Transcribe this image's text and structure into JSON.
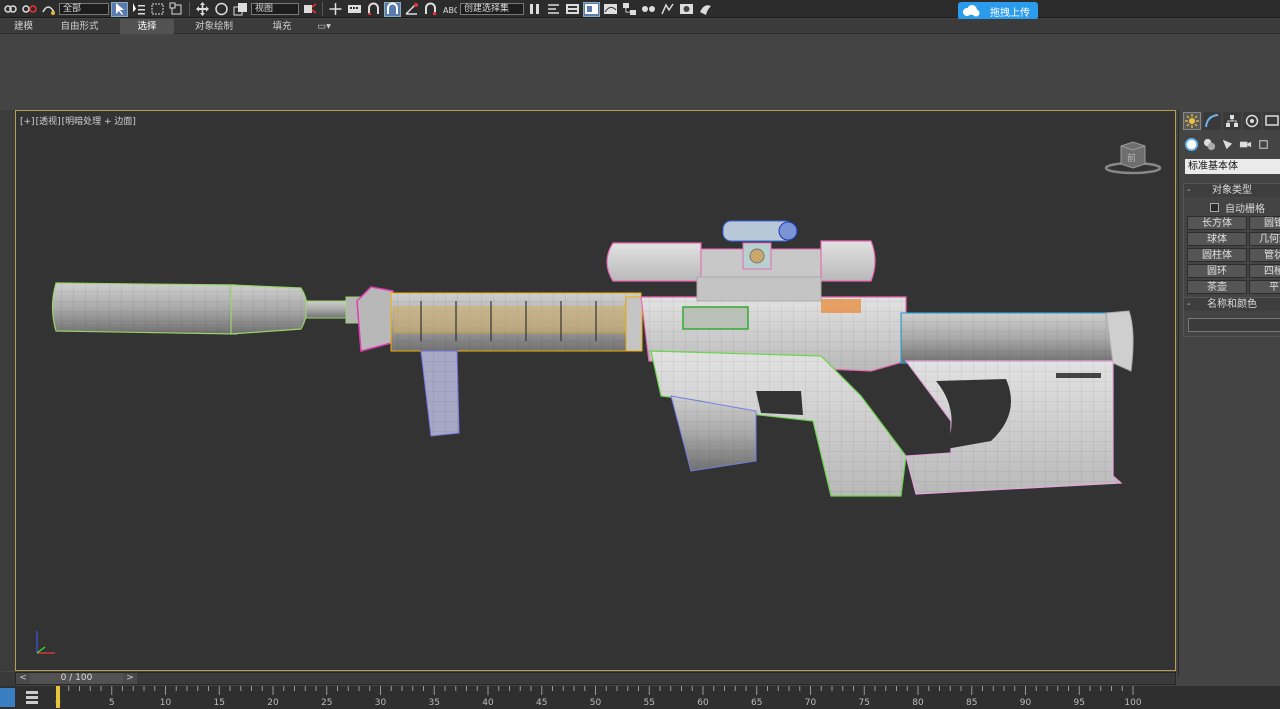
{
  "toolbar": {
    "selection_filter": "全部",
    "ref_coord": "视图",
    "named_selection": "创建选择集",
    "upload_label": "拖拽上传"
  },
  "ribbon": {
    "tabs": [
      {
        "label": "建模",
        "active": false
      },
      {
        "label": "自由形式",
        "active": false
      },
      {
        "label": "选择",
        "active": true
      },
      {
        "label": "对象绘制",
        "active": false
      },
      {
        "label": "填充",
        "active": false
      }
    ]
  },
  "viewport": {
    "label_plus": "[+]",
    "label_view": "[透视]",
    "label_shading": "[明暗处理 + 边面]",
    "viewcube_face": "前"
  },
  "command_panel": {
    "dropdown_value": "标准基本体",
    "object_type_title": "对象类型",
    "auto_grid_label": "自动栅格",
    "buttons": [
      "长方体",
      "圆锥体",
      "球体",
      "几何球体",
      "圆柱体",
      "管状体",
      "圆环",
      "四棱锥",
      "茶壶",
      "平面"
    ],
    "name_color_title": "名称和颜色"
  },
  "timeline": {
    "frame_label": "0 / 100",
    "prev": "<",
    "next": ">",
    "ticks": [
      "0",
      "5",
      "10",
      "15",
      "20",
      "25",
      "30",
      "35",
      "40",
      "45",
      "50",
      "55",
      "60",
      "65",
      "70",
      "75",
      "80",
      "85",
      "90",
      "95",
      "100"
    ]
  },
  "colors": {
    "viewport_bg": "#333333",
    "viewport_border": "#b9a04c",
    "upload_btn": "#2b9bec",
    "ui_bg": "#444444"
  }
}
